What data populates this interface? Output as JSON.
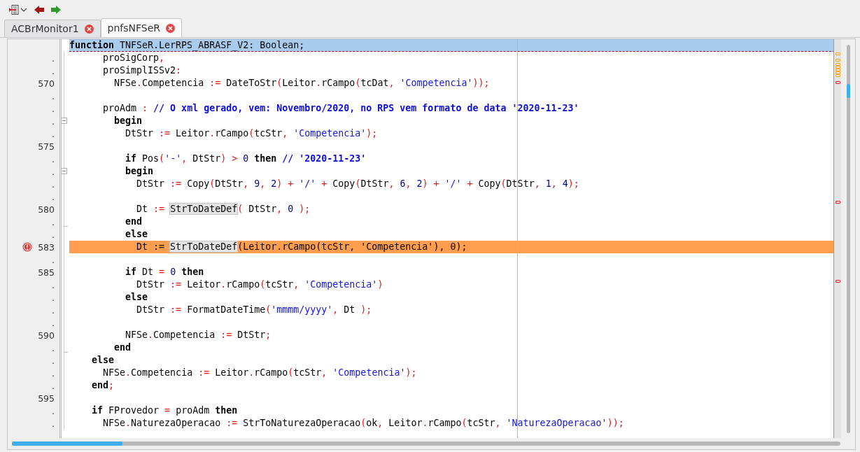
{
  "tabs": [
    {
      "label": "ACBrMonitor1",
      "selected": false
    },
    {
      "label": "pnfsNFSeR",
      "selected": true
    }
  ],
  "editor": {
    "lines": [
      {
        "current": true,
        "error": false,
        "collapsible": false,
        "block_end": false,
        "tokens": [
          {
            "kind": "keyword",
            "text": "function"
          },
          {
            "kind": "plain",
            "text": " TNFSeR.LerRPS_ABRASF_V2"
          },
          {
            "kind": "symbol",
            "text": ":"
          },
          {
            "kind": "plain",
            "text": " Boolean"
          },
          {
            "kind": "symbol",
            "text": ";"
          }
        ]
      },
      {
        "gutter": ".",
        "current": false,
        "error": false,
        "collapsible": false,
        "block_end": false,
        "tokens": [
          {
            "kind": "plain",
            "text": "      proSigCorp"
          },
          {
            "kind": "symbol",
            "text": ","
          }
        ]
      },
      {
        "gutter": ".",
        "current": false,
        "error": false,
        "collapsible": false,
        "block_end": false,
        "tokens": [
          {
            "kind": "plain",
            "text": "      proSimplISSv2"
          },
          {
            "kind": "symbol",
            "text": ":"
          }
        ]
      },
      {
        "gutter": "570",
        "current": false,
        "error": false,
        "collapsible": false,
        "block_end": false,
        "tokens": [
          {
            "kind": "plain",
            "text": "        NFSe"
          },
          {
            "kind": "symbol",
            "text": "."
          },
          {
            "kind": "plain",
            "text": "Competencia "
          },
          {
            "kind": "symbol",
            "text": ":="
          },
          {
            "kind": "plain",
            "text": " DateToStr"
          },
          {
            "kind": "symbol",
            "text": "("
          },
          {
            "kind": "plain",
            "text": "Leitor"
          },
          {
            "kind": "symbol",
            "text": "."
          },
          {
            "kind": "plain",
            "text": "rCampo"
          },
          {
            "kind": "symbol",
            "text": "("
          },
          {
            "kind": "plain",
            "text": "tcDat"
          },
          {
            "kind": "symbol",
            "text": ", "
          },
          {
            "kind": "string",
            "text": "'Competencia'"
          },
          {
            "kind": "symbol",
            "text": "));"
          }
        ]
      },
      {
        "gutter": ".",
        "current": false,
        "error": false,
        "collapsible": false,
        "block_end": false
      },
      {
        "gutter": ".",
        "current": false,
        "error": false,
        "collapsible": false,
        "block_end": false,
        "tokens": [
          {
            "kind": "plain",
            "text": "      proAdm "
          },
          {
            "kind": "symbol",
            "text": ": "
          },
          {
            "kind": "comment",
            "text": "// O xml gerado, vem: Novembro/2020, no RPS vem formato de data '2020-11-23'"
          }
        ]
      },
      {
        "gutter": ".",
        "current": false,
        "error": false,
        "collapsible": true,
        "block_end": false,
        "tokens": [
          {
            "kind": "keyword",
            "text": "        begin"
          }
        ]
      },
      {
        "gutter": ".",
        "current": false,
        "error": false,
        "collapsible": false,
        "block_end": false,
        "tokens": [
          {
            "kind": "plain",
            "text": "          DtStr "
          },
          {
            "kind": "symbol",
            "text": ":="
          },
          {
            "kind": "plain",
            "text": " Leitor"
          },
          {
            "kind": "symbol",
            "text": "."
          },
          {
            "kind": "plain",
            "text": "rCampo"
          },
          {
            "kind": "symbol",
            "text": "("
          },
          {
            "kind": "plain",
            "text": "tcStr"
          },
          {
            "kind": "symbol",
            "text": ", "
          },
          {
            "kind": "string",
            "text": "'Competencia'"
          },
          {
            "kind": "symbol",
            "text": ");"
          }
        ]
      },
      {
        "gutter": "575",
        "current": false,
        "error": false,
        "collapsible": false,
        "block_end": false
      },
      {
        "gutter": ".",
        "current": false,
        "error": false,
        "collapsible": false,
        "block_end": false,
        "tokens": [
          {
            "kind": "keyword",
            "text": "          if"
          },
          {
            "kind": "plain",
            "text": " Pos"
          },
          {
            "kind": "symbol",
            "text": "("
          },
          {
            "kind": "string",
            "text": "'-'"
          },
          {
            "kind": "symbol",
            "text": ","
          },
          {
            "kind": "plain",
            "text": " DtStr"
          },
          {
            "kind": "symbol",
            "text": ") > "
          },
          {
            "kind": "number",
            "text": "0 "
          },
          {
            "kind": "keyword",
            "text": "then "
          },
          {
            "kind": "comment",
            "text": "// '2020-11-23'"
          }
        ]
      },
      {
        "gutter": ".",
        "current": false,
        "error": false,
        "collapsible": true,
        "block_end": false,
        "tokens": [
          {
            "kind": "keyword",
            "text": "          begin"
          }
        ]
      },
      {
        "gutter": ".",
        "current": false,
        "error": false,
        "collapsible": false,
        "block_end": false,
        "tokens": [
          {
            "kind": "plain",
            "text": "            DtStr "
          },
          {
            "kind": "symbol",
            "text": ":="
          },
          {
            "kind": "plain",
            "text": " Copy"
          },
          {
            "kind": "symbol",
            "text": "("
          },
          {
            "kind": "plain",
            "text": "DtStr"
          },
          {
            "kind": "symbol",
            "text": ", "
          },
          {
            "kind": "number",
            "text": "9"
          },
          {
            "kind": "symbol",
            "text": ", "
          },
          {
            "kind": "number",
            "text": "2"
          },
          {
            "kind": "symbol",
            "text": ") + "
          },
          {
            "kind": "string",
            "text": "'/'"
          },
          {
            "kind": "symbol",
            "text": " +"
          },
          {
            "kind": "plain",
            "text": " Copy"
          },
          {
            "kind": "symbol",
            "text": "("
          },
          {
            "kind": "plain",
            "text": "DtStr"
          },
          {
            "kind": "symbol",
            "text": ", "
          },
          {
            "kind": "number",
            "text": "6"
          },
          {
            "kind": "symbol",
            "text": ", "
          },
          {
            "kind": "number",
            "text": "2"
          },
          {
            "kind": "symbol",
            "text": ") + "
          },
          {
            "kind": "string",
            "text": "'/'"
          },
          {
            "kind": "symbol",
            "text": " +"
          },
          {
            "kind": "plain",
            "text": " Copy"
          },
          {
            "kind": "symbol",
            "text": "("
          },
          {
            "kind": "plain",
            "text": "DtStr"
          },
          {
            "kind": "symbol",
            "text": ", "
          },
          {
            "kind": "number",
            "text": "1"
          },
          {
            "kind": "symbol",
            "text": ", "
          },
          {
            "kind": "number",
            "text": "4"
          },
          {
            "kind": "symbol",
            "text": ");"
          }
        ]
      },
      {
        "gutter": ".",
        "current": false,
        "error": false,
        "collapsible": false,
        "block_end": false
      },
      {
        "gutter": "580",
        "current": false,
        "error": false,
        "collapsible": false,
        "block_end": false,
        "tokens": [
          {
            "kind": "plain",
            "text": "            Dt "
          },
          {
            "kind": "symbol",
            "text": ":= "
          },
          {
            "kind": "match",
            "text": "StrToDateDef"
          },
          {
            "kind": "symbol",
            "text": "("
          },
          {
            "kind": "plain",
            "text": " DtStr"
          },
          {
            "kind": "symbol",
            "text": ", "
          },
          {
            "kind": "number",
            "text": "0"
          },
          {
            "kind": "symbol",
            "text": " );"
          }
        ]
      },
      {
        "gutter": ".",
        "current": false,
        "error": false,
        "collapsible": false,
        "block_end": true,
        "tokens": [
          {
            "kind": "keyword",
            "text": "          end"
          }
        ]
      },
      {
        "gutter": ".",
        "current": false,
        "error": false,
        "collapsible": false,
        "block_end": false,
        "tokens": [
          {
            "kind": "keyword",
            "text": "          else"
          }
        ]
      },
      {
        "gutter": "583",
        "current": false,
        "error": true,
        "collapsible": false,
        "block_end": false,
        "tokens": [
          {
            "kind": "plain",
            "text": "            Dt := "
          },
          {
            "kind": "match",
            "text": "StrToDateDef"
          },
          {
            "kind": "plain",
            "text": "(Leitor.rCampo(tcStr, 'Competencia'), 0);"
          }
        ]
      },
      {
        "gutter": ".",
        "current": false,
        "error": false,
        "collapsible": false,
        "block_end": false
      },
      {
        "gutter": "585",
        "current": false,
        "error": false,
        "collapsible": false,
        "block_end": false,
        "tokens": [
          {
            "kind": "keyword",
            "text": "          if"
          },
          {
            "kind": "plain",
            "text": " Dt "
          },
          {
            "kind": "symbol",
            "text": "= "
          },
          {
            "kind": "number",
            "text": "0 "
          },
          {
            "kind": "keyword",
            "text": "then"
          }
        ]
      },
      {
        "gutter": ".",
        "current": false,
        "error": false,
        "collapsible": false,
        "block_end": false,
        "tokens": [
          {
            "kind": "plain",
            "text": "            DtStr "
          },
          {
            "kind": "symbol",
            "text": ":="
          },
          {
            "kind": "plain",
            "text": " Leitor"
          },
          {
            "kind": "symbol",
            "text": "."
          },
          {
            "kind": "plain",
            "text": "rCampo"
          },
          {
            "kind": "symbol",
            "text": "("
          },
          {
            "kind": "plain",
            "text": "tcStr"
          },
          {
            "kind": "symbol",
            "text": ", "
          },
          {
            "kind": "string",
            "text": "'Competencia'"
          },
          {
            "kind": "symbol",
            "text": ")"
          }
        ]
      },
      {
        "gutter": ".",
        "current": false,
        "error": false,
        "collapsible": false,
        "block_end": false,
        "tokens": [
          {
            "kind": "keyword",
            "text": "          else"
          }
        ]
      },
      {
        "gutter": ".",
        "current": false,
        "error": false,
        "collapsible": false,
        "block_end": false,
        "tokens": [
          {
            "kind": "plain",
            "text": "            DtStr "
          },
          {
            "kind": "symbol",
            "text": ":="
          },
          {
            "kind": "plain",
            "text": " FormatDateTime"
          },
          {
            "kind": "symbol",
            "text": "("
          },
          {
            "kind": "string",
            "text": "'mmmm/yyyy'"
          },
          {
            "kind": "symbol",
            "text": ","
          },
          {
            "kind": "plain",
            "text": " Dt "
          },
          {
            "kind": "symbol",
            "text": ");"
          }
        ]
      },
      {
        "gutter": ".",
        "current": false,
        "error": false,
        "collapsible": false,
        "block_end": false
      },
      {
        "gutter": "590",
        "current": false,
        "error": false,
        "collapsible": false,
        "block_end": false,
        "tokens": [
          {
            "kind": "plain",
            "text": "          NFSe"
          },
          {
            "kind": "symbol",
            "text": "."
          },
          {
            "kind": "plain",
            "text": "Competencia "
          },
          {
            "kind": "symbol",
            "text": ":="
          },
          {
            "kind": "plain",
            "text": " DtStr"
          },
          {
            "kind": "symbol",
            "text": ";"
          }
        ]
      },
      {
        "gutter": ".",
        "current": false,
        "error": false,
        "collapsible": false,
        "block_end": true,
        "tokens": [
          {
            "kind": "keyword",
            "text": "        end"
          }
        ]
      },
      {
        "gutter": ".",
        "current": false,
        "error": false,
        "collapsible": false,
        "block_end": false,
        "tokens": [
          {
            "kind": "keyword",
            "text": "    else"
          }
        ]
      },
      {
        "gutter": ".",
        "current": false,
        "error": false,
        "collapsible": false,
        "block_end": false,
        "tokens": [
          {
            "kind": "plain",
            "text": "      NFSe"
          },
          {
            "kind": "symbol",
            "text": "."
          },
          {
            "kind": "plain",
            "text": "Competencia "
          },
          {
            "kind": "symbol",
            "text": ":="
          },
          {
            "kind": "plain",
            "text": " Leitor"
          },
          {
            "kind": "symbol",
            "text": "."
          },
          {
            "kind": "plain",
            "text": "rCampo"
          },
          {
            "kind": "symbol",
            "text": "("
          },
          {
            "kind": "plain",
            "text": "tcStr"
          },
          {
            "kind": "symbol",
            "text": ", "
          },
          {
            "kind": "string",
            "text": "'Competencia'"
          },
          {
            "kind": "symbol",
            "text": ");"
          }
        ]
      },
      {
        "gutter": ".",
        "current": false,
        "error": false,
        "collapsible": false,
        "block_end": false,
        "tokens": [
          {
            "kind": "keyword",
            "text": "    end"
          },
          {
            "kind": "symbol",
            "text": ";"
          }
        ]
      },
      {
        "gutter": "595",
        "current": false,
        "error": false,
        "collapsible": false,
        "block_end": false
      },
      {
        "gutter": ".",
        "current": false,
        "error": false,
        "collapsible": false,
        "block_end": false,
        "tokens": [
          {
            "kind": "keyword",
            "text": "    if"
          },
          {
            "kind": "plain",
            "text": " FProvedor "
          },
          {
            "kind": "symbol",
            "text": "= "
          },
          {
            "kind": "plain",
            "text": "proAdm "
          },
          {
            "kind": "keyword",
            "text": "then"
          }
        ]
      },
      {
        "gutter": ".",
        "current": false,
        "error": false,
        "collapsible": false,
        "block_end": false,
        "tokens": [
          {
            "kind": "plain",
            "text": "      NFSe"
          },
          {
            "kind": "symbol",
            "text": "."
          },
          {
            "kind": "plain",
            "text": "NaturezaOperacao "
          },
          {
            "kind": "symbol",
            "text": ":="
          },
          {
            "kind": "plain",
            "text": " StrToNaturezaOperacao"
          },
          {
            "kind": "symbol",
            "text": "("
          },
          {
            "kind": "plain",
            "text": "ok"
          },
          {
            "kind": "symbol",
            "text": ","
          },
          {
            "kind": "plain",
            "text": " Leitor"
          },
          {
            "kind": "symbol",
            "text": "."
          },
          {
            "kind": "plain",
            "text": "rCampo"
          },
          {
            "kind": "symbol",
            "text": "("
          },
          {
            "kind": "plain",
            "text": "tcStr"
          },
          {
            "kind": "symbol",
            "text": ", "
          },
          {
            "kind": "string",
            "text": "'NaturezaOperacao'"
          },
          {
            "kind": "symbol",
            "text": "));"
          }
        ]
      }
    ]
  }
}
